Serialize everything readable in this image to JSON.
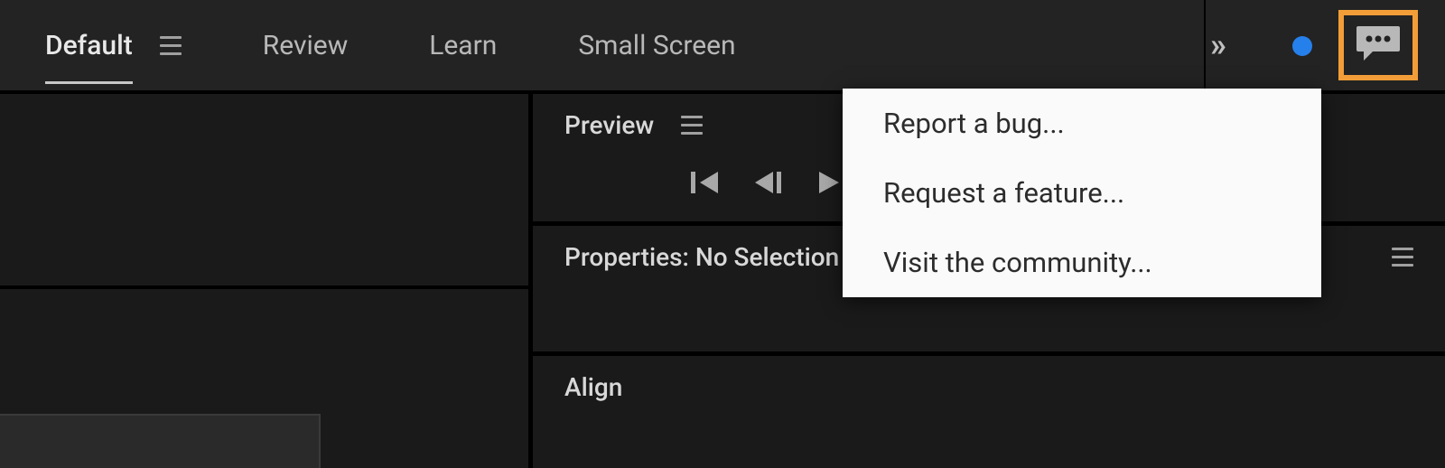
{
  "workspaces": {
    "default": "Default",
    "review": "Review",
    "learn": "Learn",
    "small_screen": "Small Screen"
  },
  "panels": {
    "preview_title": "Preview",
    "properties_title": "Properties: No Selection",
    "align_title": "Align"
  },
  "feedback_menu": {
    "report_bug": "Report a bug...",
    "request_feature": "Request a feature...",
    "visit_community": "Visit the community..."
  }
}
